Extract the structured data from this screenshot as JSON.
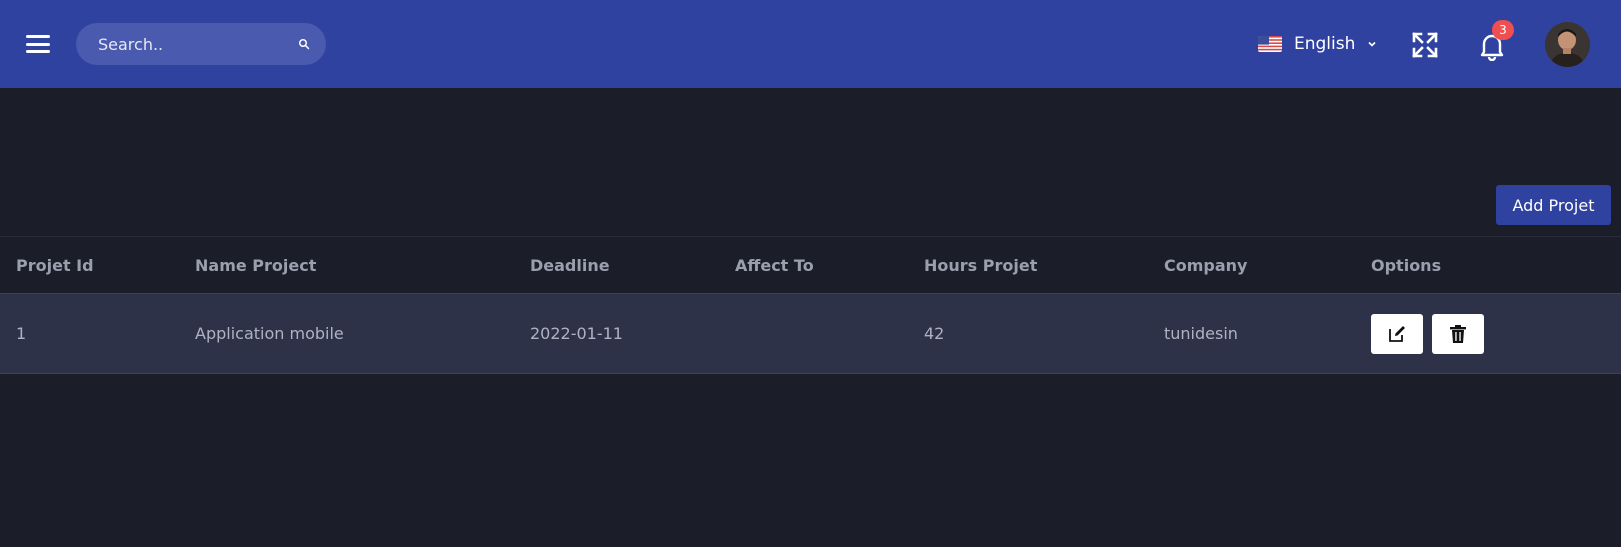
{
  "topbar": {
    "search_placeholder": "Search..",
    "language_label": "English",
    "notification_count": "3",
    "colors": {
      "bar": "#2f42a0",
      "search_bg": "#4a5aae",
      "badge": "#ef4f4f"
    }
  },
  "toolbar": {
    "add_label": "Add Projet"
  },
  "table": {
    "headers": [
      "Projet Id",
      "Name Project",
      "Deadline",
      "Affect To",
      "Hours Projet",
      "Company",
      "Options"
    ],
    "rows": [
      {
        "id": "1",
        "name": "Application mobile",
        "deadline": "2022-01-11",
        "affect_to": "",
        "hours": "42",
        "company": "tunidesin"
      }
    ]
  },
  "icons": {
    "menu": "hamburger-icon",
    "search": "search-icon",
    "flag": "us-flag-icon",
    "chevron": "chevron-down-icon",
    "fullscreen": "expand-icon",
    "notifications": "bell-icon",
    "edit": "edit-icon",
    "delete": "trash-icon"
  }
}
